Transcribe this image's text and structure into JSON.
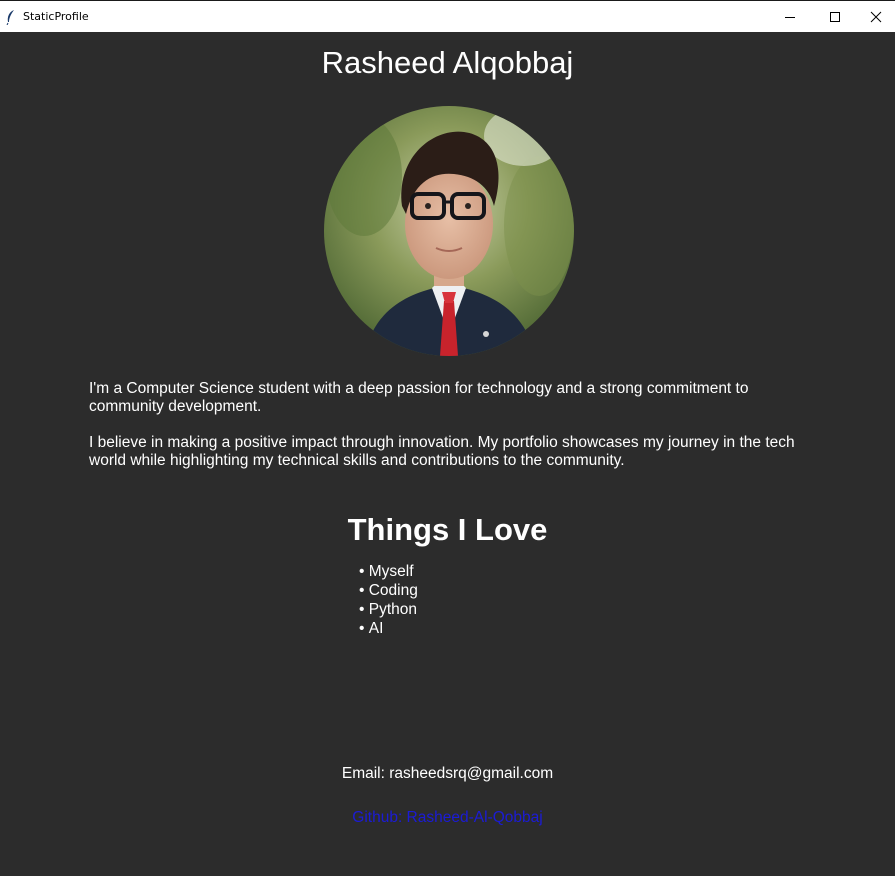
{
  "window": {
    "title": "StaticProfile",
    "app_icon": "feather-icon",
    "controls": [
      "minimize-icon",
      "maximize-icon",
      "close-icon"
    ]
  },
  "profile": {
    "name": "Rasheed Alqobbaj",
    "photo_icon": "profile-photo",
    "bio_paragraph_1": "I'm a Computer Science student with a deep passion for technology and a strong commitment to community development.",
    "bio_paragraph_2": "I believe in making a positive impact through innovation. My portfolio showcases my journey in the tech world while highlighting my technical skills and contributions to the community."
  },
  "love": {
    "title": "Things I Love",
    "items": [
      "Myself",
      "Coding",
      "Python",
      "AI"
    ]
  },
  "contact": {
    "email_text": "Email: rasheedsrq@gmail.com",
    "github_text": "Github: Rasheed-Al-Qobbaj"
  },
  "colors": {
    "background": "#2c2c2c",
    "text": "#ffffff",
    "link": "#1b1bd6"
  }
}
